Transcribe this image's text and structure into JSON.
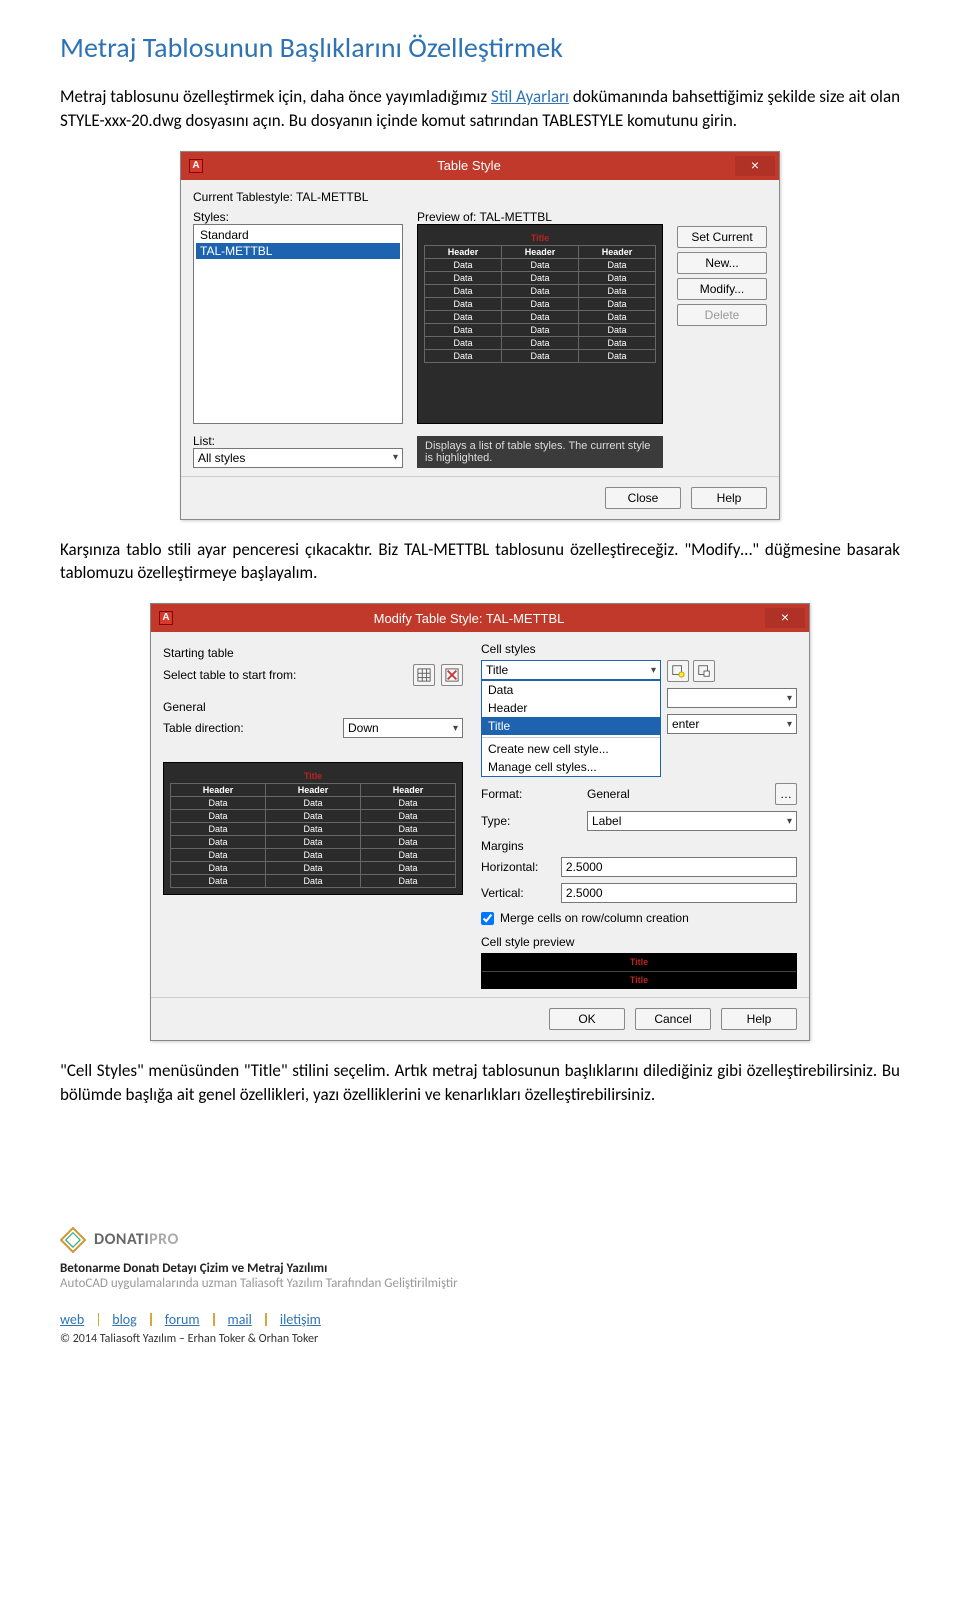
{
  "heading": "Metraj Tablosunun Başlıklarını Özelleştirmek",
  "para1_pre": "Metraj tablosunu özelleştirmek için, daha önce yayımladığımız ",
  "para1_link": "Stil Ayarları",
  "para1_post": " dokümanında bahsettiğimiz şekilde size ait olan STYLE-xxx-20.dwg dosyasını açın. Bu dosyanın içinde komut satırından TABLESTYLE komutunu girin.",
  "para2": "Karşınıza tablo stili ayar penceresi çıkacaktır. Biz TAL-METTBL tablosunu özelleştireceğiz. \"Modify…\" düğmesine basarak tablomuzu özelleştirmeye başlayalım.",
  "para3": "\"Cell Styles\" menüsünden \"Title\" stilini seçelim. Artık metraj tablosunun başlıklarını dilediğiniz gibi özelleştirebilirsiniz. Bu bölümde başlığa ait genel özellikleri, yazı özelliklerini ve kenarlıkları özelleştirebilirsiniz.",
  "dialog1": {
    "title": "Table Style",
    "current_label": "Current Tablestyle: TAL-METTBL",
    "styles_label": "Styles:",
    "styles": [
      "Standard",
      "TAL-METTBL"
    ],
    "preview_label": "Preview of: TAL-METTBL",
    "btn_set_current": "Set Current",
    "btn_new": "New...",
    "btn_modify": "Modify...",
    "btn_delete": "Delete",
    "list_label": "List:",
    "list_value": "All styles",
    "tooltip": "Displays a list of table styles. The current style is highlighted.",
    "btn_close": "Close",
    "btn_help": "Help",
    "preview": {
      "title": "Title",
      "header": "Header",
      "data": "Data"
    }
  },
  "dialog2": {
    "title": "Modify Table Style: TAL-METTBL",
    "starting_table": "Starting table",
    "select_table_label": "Select table to start from:",
    "general": "General",
    "table_direction_label": "Table direction:",
    "table_direction_value": "Down",
    "cell_styles": "Cell styles",
    "cell_combo_value": "Title",
    "cell_options": [
      "Data",
      "Header",
      "Title"
    ],
    "cell_create": "Create new cell style...",
    "cell_manage": "Manage cell styles...",
    "enter": "enter",
    "format_label": "Format:",
    "format_value": "General",
    "type_label": "Type:",
    "type_value": "Label",
    "margins": "Margins",
    "horizontal_label": "Horizontal:",
    "horizontal_value": "2.5000",
    "vertical_label": "Vertical:",
    "vertical_value": "2.5000",
    "merge_label": "Merge cells on row/column creation",
    "cell_preview_label": "Cell style preview",
    "cell_preview_text": "Title",
    "btn_ok": "OK",
    "btn_cancel": "Cancel",
    "btn_help": "Help",
    "preview": {
      "title": "Title",
      "header": "Header",
      "data": "Data"
    }
  },
  "footer": {
    "brand1": "DONATI",
    "brand2": "PRO",
    "sub1": "Betonarme Donatı Detayı Çizim ve Metraj Yazılımı",
    "sub2": "AutoCAD uygulamalarında uzman Taliasoft Yazılım Tarafından Geliştirilmiştir",
    "links": [
      "web",
      "blog",
      "forum",
      "mail",
      "iletişim"
    ],
    "copyright": "© 2014 Taliasoft Yazılım – Erhan Toker & Orhan Toker"
  }
}
